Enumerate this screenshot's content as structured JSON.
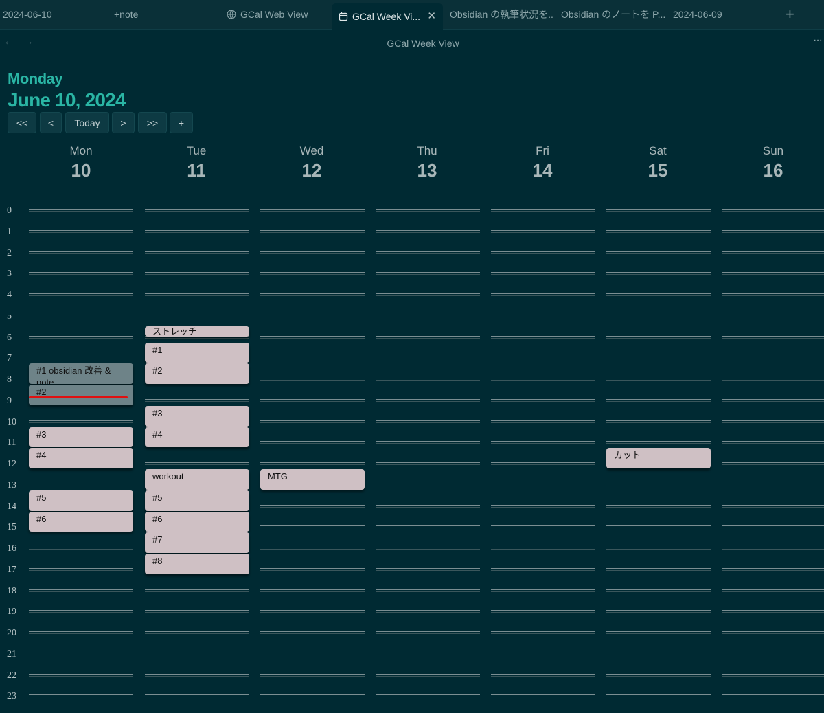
{
  "tabs": [
    {
      "label": "2024-06-10"
    },
    {
      "label": "+note"
    },
    {
      "label": "GCal Web View",
      "icon": "globe-icon"
    },
    {
      "label": "GCal Week Vi...",
      "icon": "calendar-icon",
      "active": true
    },
    {
      "label": "Obsidian の執筆状況を..."
    },
    {
      "label": "Obsidian のノートを P..."
    },
    {
      "label": "2024-06-09"
    }
  ],
  "view_title": "GCal Week View",
  "header": {
    "day_name": "Monday",
    "date": "June 10, 2024",
    "buttons": [
      "<<",
      "<",
      "Today",
      ">",
      ">>",
      "+"
    ]
  },
  "days": [
    {
      "name": "Mon",
      "num": "10"
    },
    {
      "name": "Tue",
      "num": "11"
    },
    {
      "name": "Wed",
      "num": "12"
    },
    {
      "name": "Thu",
      "num": "13"
    },
    {
      "name": "Fri",
      "num": "14"
    },
    {
      "name": "Sat",
      "num": "15"
    },
    {
      "name": "Sun",
      "num": "16"
    }
  ],
  "hours": [
    "0",
    "1",
    "2",
    "3",
    "4",
    "5",
    "6",
    "7",
    "8",
    "9",
    "10",
    "11",
    "12",
    "13",
    "14",
    "15",
    "16",
    "17",
    "18",
    "19",
    "20",
    "21",
    "22",
    "23"
  ],
  "events": [
    {
      "day": 0,
      "start": 7,
      "end": 8,
      "title": "#1 obsidian 改善 & note",
      "dim": true
    },
    {
      "day": 0,
      "start": 8,
      "end": 9,
      "title": "#2",
      "dim": true
    },
    {
      "day": 0,
      "start": 10,
      "end": 11,
      "title": "#3"
    },
    {
      "day": 0,
      "start": 11,
      "end": 12,
      "title": "#4"
    },
    {
      "day": 0,
      "start": 13,
      "end": 14,
      "title": "#5"
    },
    {
      "day": 0,
      "start": 14,
      "end": 15,
      "title": "#6"
    },
    {
      "day": 1,
      "start": 5.25,
      "end": 5.75,
      "title": "ストレッチ"
    },
    {
      "day": 1,
      "start": 6,
      "end": 7,
      "title": "#1"
    },
    {
      "day": 1,
      "start": 7,
      "end": 8,
      "title": "#2"
    },
    {
      "day": 1,
      "start": 9,
      "end": 10,
      "title": "#3"
    },
    {
      "day": 1,
      "start": 10,
      "end": 11,
      "title": "#4"
    },
    {
      "day": 1,
      "start": 12,
      "end": 13,
      "title": "workout"
    },
    {
      "day": 1,
      "start": 13,
      "end": 14,
      "title": "#5"
    },
    {
      "day": 1,
      "start": 14,
      "end": 15,
      "title": "#6"
    },
    {
      "day": 1,
      "start": 15,
      "end": 16,
      "title": "#7"
    },
    {
      "day": 1,
      "start": 16,
      "end": 17,
      "title": "#8"
    },
    {
      "day": 2,
      "start": 12,
      "end": 13,
      "title": "MTG"
    },
    {
      "day": 5,
      "start": 11,
      "end": 12,
      "title": "カット"
    }
  ],
  "current_time": {
    "day": 0,
    "hour": 9
  }
}
